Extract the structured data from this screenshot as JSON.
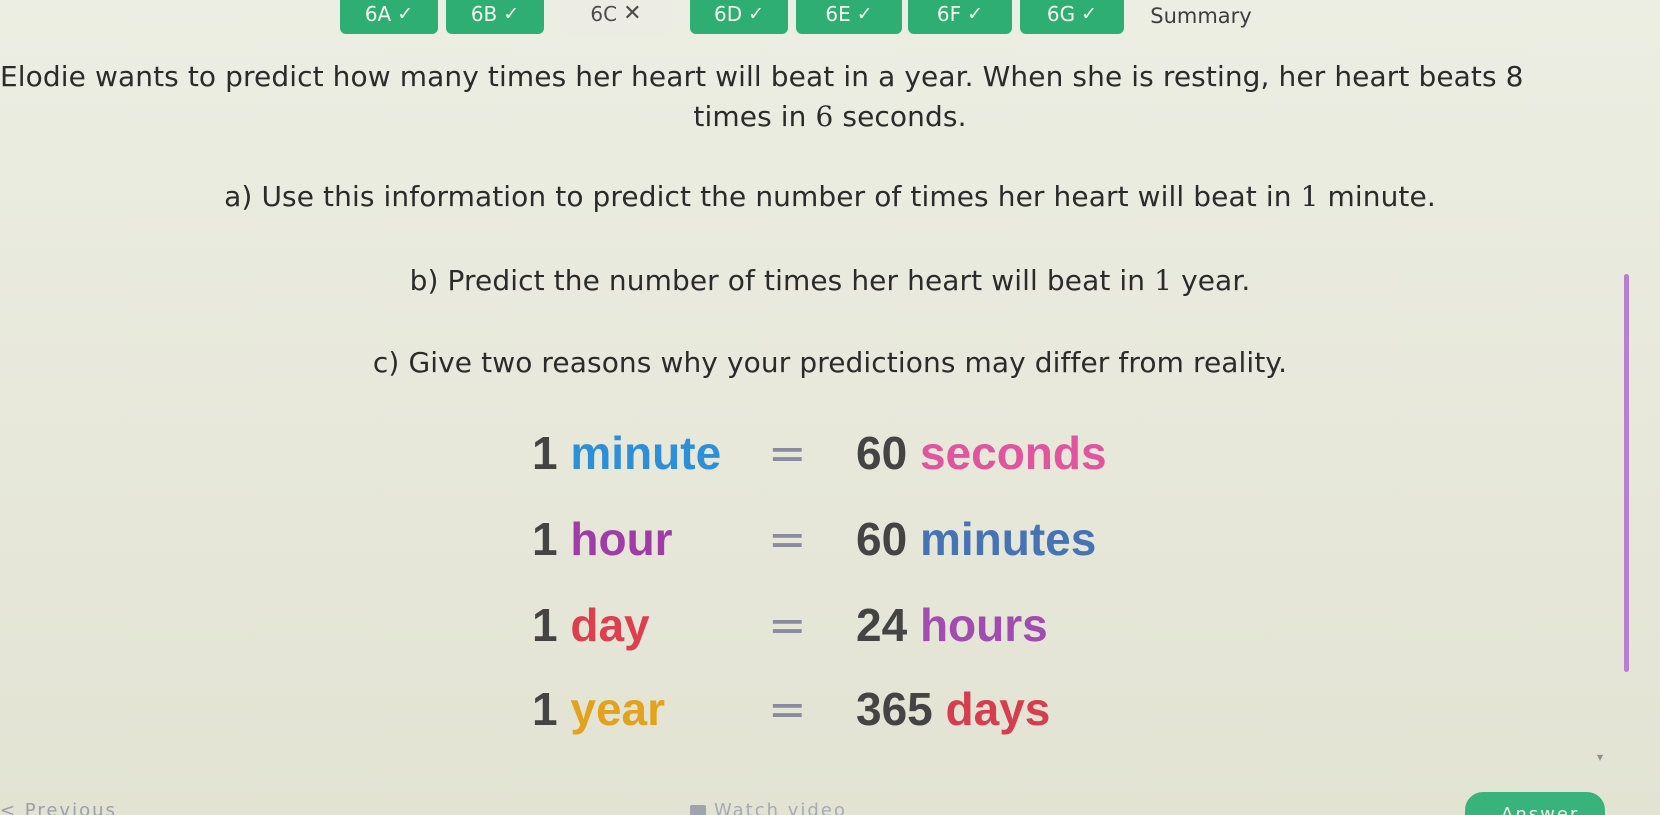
{
  "tabs": [
    {
      "label": "6A",
      "status": "✓"
    },
    {
      "label": "6B",
      "status": "✓"
    },
    {
      "label": "6C",
      "status": "✕"
    },
    {
      "label": "6D",
      "status": "✓"
    },
    {
      "label": "6E",
      "status": "✓"
    },
    {
      "label": "6F",
      "status": "✓"
    },
    {
      "label": "6G",
      "status": "✓"
    },
    {
      "label": "Summary",
      "status": ""
    }
  ],
  "question": {
    "intro_line1": "Elodie wants to predict how many times her heart will beat in a year. When she is resting, her heart beats 8",
    "intro_line2_pre": "times in ",
    "intro_line2_num": "6",
    "intro_line2_post": " seconds.",
    "part_a_pre": "a) Use this information to predict the number of times her heart will beat in ",
    "part_a_num": "1",
    "part_a_post": " minute.",
    "part_b_pre": "b) Predict the number of times her heart will beat in ",
    "part_b_num": "1",
    "part_b_post": " year.",
    "part_c": "c) Give two reasons why your predictions may differ from reality."
  },
  "conversions": [
    {
      "lhs_num": "1",
      "lhs_unit": "minute",
      "eq": "=",
      "rhs_num": "60",
      "rhs_unit": "seconds"
    },
    {
      "lhs_num": "1",
      "lhs_unit": "hour",
      "eq": "=",
      "rhs_num": "60",
      "rhs_unit": "minutes"
    },
    {
      "lhs_num": "1",
      "lhs_unit": "day",
      "eq": "=",
      "rhs_num": "24",
      "rhs_unit": "hours"
    },
    {
      "lhs_num": "1",
      "lhs_unit": "year",
      "eq": "=",
      "rhs_num": "365",
      "rhs_unit": "days"
    }
  ],
  "footer": {
    "previous_label": "< Previous",
    "watch_video_label": "Watch video",
    "answer_label": "Answer"
  },
  "colors": {
    "tab_done": "#2fae73",
    "answer_button": "#37b37b",
    "scrollbar": "#b67fd0"
  }
}
